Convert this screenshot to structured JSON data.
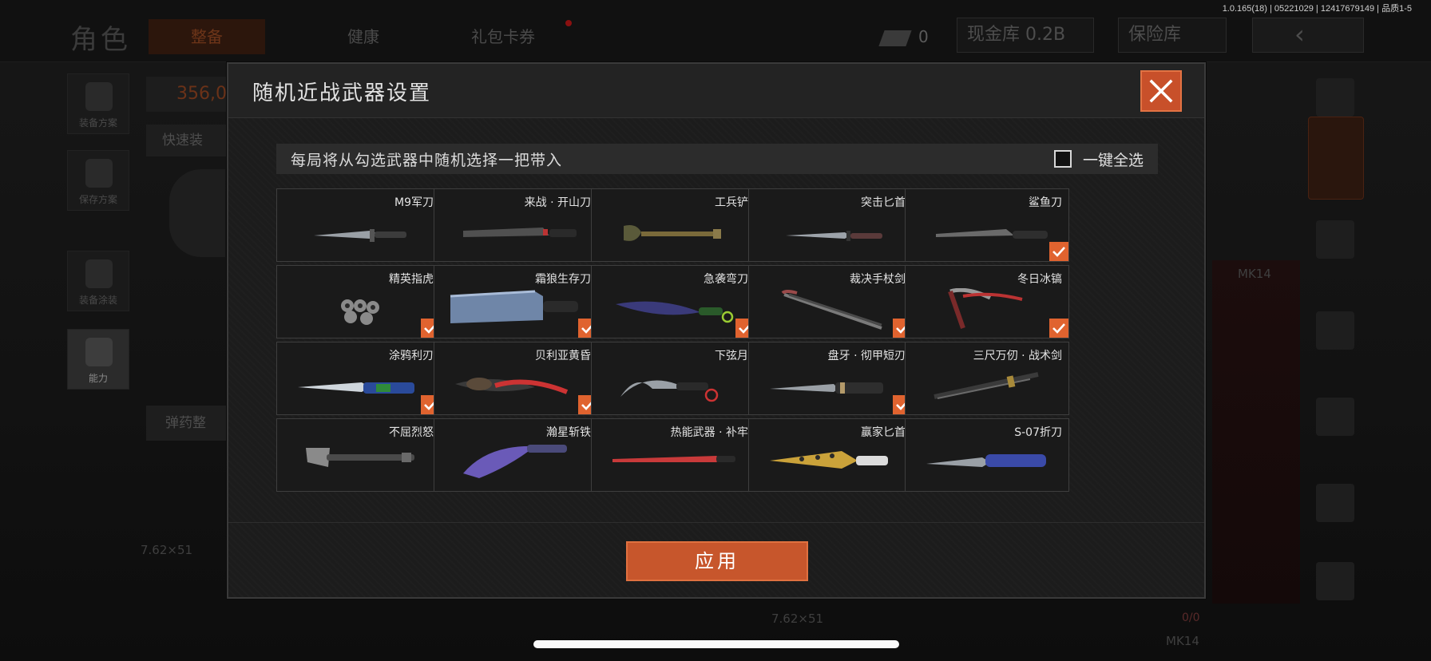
{
  "topbar": {
    "title": "角色",
    "tabs": [
      "整备",
      "健康",
      "礼包卡券"
    ],
    "ticket_count": "0",
    "cash_label": "现金库 0.2B",
    "vault_label": "保险库",
    "version": "1.0.165(18) | 05221029 | 12417679149 | 品质1-5"
  },
  "left_rail": [
    "装备方案",
    "保存方案",
    "装备涂装",
    "能力"
  ],
  "background": {
    "currency": "356,0",
    "quick_equip": "快速装",
    "ammo": "弹药整",
    "caliber_left": "7.62×51",
    "caliber_right": "7.62×51",
    "weapon_top": "MK14",
    "weapon_bottom": "MK14",
    "ammo_count": "0/0"
  },
  "modal": {
    "title": "随机近战武器设置",
    "instruction": "每局将从勾选武器中随机选择一把带入",
    "select_all": "一键全选",
    "apply": "应用",
    "accent_color": "#e0632f",
    "weapons": [
      {
        "name": "M9军刀",
        "checked": false,
        "icon": "bayonet"
      },
      {
        "name": "来战 · 开山刀",
        "checked": false,
        "icon": "machete"
      },
      {
        "name": "工兵铲",
        "checked": false,
        "icon": "shovel"
      },
      {
        "name": "突击匕首",
        "checked": false,
        "icon": "dagger"
      },
      {
        "name": "鲨鱼刀",
        "checked": true,
        "icon": "shark-knife"
      },
      {
        "name": "精英指虎",
        "checked": true,
        "icon": "knuckles"
      },
      {
        "name": "霜狼生存刀",
        "checked": true,
        "icon": "survival-knife"
      },
      {
        "name": "急袭弯刀",
        "checked": true,
        "icon": "curved-knife"
      },
      {
        "name": "裁决手杖剑",
        "checked": true,
        "icon": "cane-sword"
      },
      {
        "name": "冬日冰镐",
        "checked": true,
        "icon": "ice-pick"
      },
      {
        "name": "涂鸦利刃",
        "checked": true,
        "icon": "graffiti-blade"
      },
      {
        "name": "贝利亚黄昏",
        "checked": true,
        "icon": "twilight-blade"
      },
      {
        "name": "下弦月",
        "checked": false,
        "icon": "karambit"
      },
      {
        "name": "盘牙 · 彻甲短刃",
        "checked": true,
        "icon": "short-blade"
      },
      {
        "name": "三尺万仞 · 战术剑",
        "checked": false,
        "icon": "tactical-sword"
      },
      {
        "name": "不屈烈怒",
        "checked": false,
        "icon": "axe"
      },
      {
        "name": "瀚星斩铁",
        "checked": false,
        "icon": "star-cleaver"
      },
      {
        "name": "热能武器 · 补牢",
        "checked": false,
        "icon": "thermal-blade"
      },
      {
        "name": "赢家匕首",
        "checked": false,
        "icon": "gold-dagger"
      },
      {
        "name": "S-07折刀",
        "checked": false,
        "icon": "folding-knife"
      }
    ]
  }
}
